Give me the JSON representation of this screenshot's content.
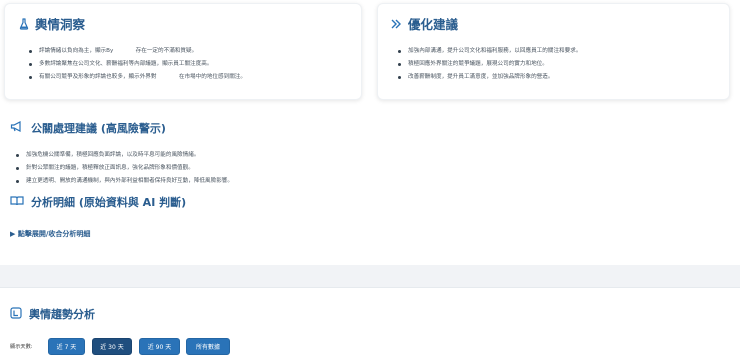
{
  "insights_card": {
    "title": "輿情洞察",
    "icon": "flask-icon",
    "bullets": [
      "評論情緒以負向為主，顯示By　　　　存在一定的不滿和質疑。",
      "多數評論聚焦在公司文化、薪酬福利等內部議題，顯示員工關注度高。",
      "有關公司競爭及形象的評論也較多，顯示外界對　　　　在市場中的地位感到關注。"
    ]
  },
  "optimize_card": {
    "title": "優化建議",
    "icon": "double-chevron-icon",
    "bullets": [
      "加強內部溝通，提升公司文化和福利服務，以回應員工的關注和要求。",
      "積極回應外界關注的競爭議題，展現公司的實力和地位。",
      "改善薪酬制度，提升員工滿意度，並加強品牌形象的營造。"
    ]
  },
  "pr_section": {
    "title": "公關處理建議 (高風險警示)",
    "icon": "megaphone-icon",
    "bullets": [
      "加強危機公關準備，積極回應負面評論，以及時平息可能的風險情緒。",
      "針對公眾關注的議題，積極釋放正面訊息，強化品牌形象和價值觀。",
      "建立更透明、開放的溝通機制，與內外部利益相關者保持良好互動，降低風險影響。"
    ]
  },
  "analysis_section": {
    "title": "分析明細 (原始資料與 AI 判斷)",
    "icon": "book-open-icon",
    "toggle_label": "▶ 點擊展開/收合分析明細"
  },
  "trend_section": {
    "title": "輿情趨勢分析",
    "icon": "chart-box-icon",
    "days_label": "顯示天數:",
    "buttons": [
      "近 7 天",
      "近 30 天",
      "近 90 天",
      "所有數據"
    ],
    "active_button": "近 30 天"
  },
  "colors": {
    "accent": "#2a5d8f",
    "button": "#2a73b8",
    "button_active": "#1f4e7e",
    "band": "#f1f3f6"
  }
}
